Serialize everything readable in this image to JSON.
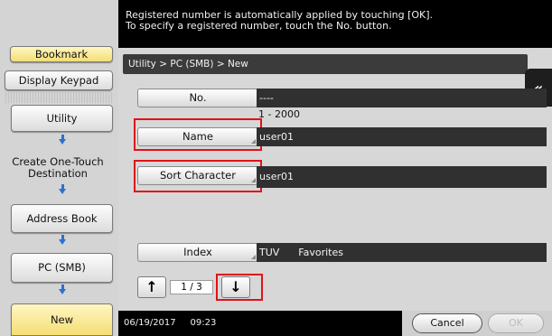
{
  "top_message": {
    "line1": "Registered number is automatically applied by touching [OK].",
    "line2": "To specify a registered number, touch the No. button."
  },
  "left_menu": {
    "bookmark": "Bookmark",
    "display_keypad": "Display Keypad",
    "path": [
      {
        "label": "Utility"
      },
      {
        "label": "Create One-Touch\nDestination"
      },
      {
        "label": "Address Book"
      },
      {
        "label": "PC (SMB)"
      },
      {
        "label": "New"
      }
    ]
  },
  "breadcrumb": "Utility > PC (SMB) > New",
  "form": {
    "no": {
      "label": "No.",
      "value": "----",
      "range": "1 - 2000"
    },
    "name": {
      "label": "Name",
      "value": "user01"
    },
    "sort_character": {
      "label": "Sort Character",
      "value": "user01"
    },
    "index": {
      "label": "Index",
      "value": "TUV      Favorites"
    }
  },
  "pager": {
    "current": "1",
    "total": "3",
    "separator": "/",
    "up_icon": "↑",
    "down_icon": "↓"
  },
  "footer": {
    "date": "06/19/2017",
    "time": "09:23",
    "cancel": "Cancel",
    "ok": "OK"
  },
  "side_tab_icon": "«",
  "colors": {
    "highlight_red": "#e0121a",
    "bookmark_yellow": "#f4de75",
    "arrow_blue": "#2e6fd1"
  }
}
